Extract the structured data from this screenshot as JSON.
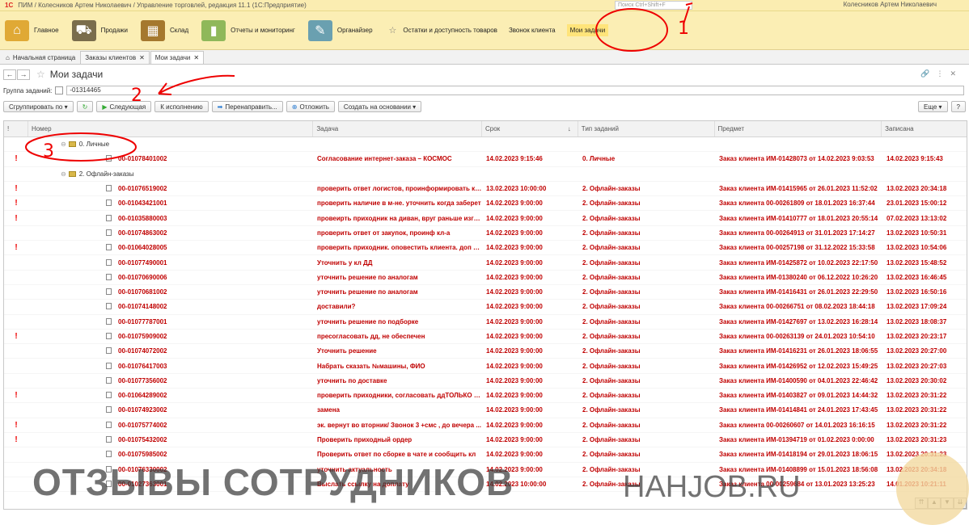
{
  "titlebar": {
    "logo": "1С",
    "title": "ПИМ / Колесников Артем Николаевич / Управление торговлей, редакция 11.1 (1С:Предприятие)",
    "search_placeholder": "Поиск Ctrl+Shift+F",
    "user": "Колесников Артем Николаевич"
  },
  "sections": [
    {
      "label": "Главное",
      "icon": "home-icon",
      "color": "#e0a935"
    },
    {
      "label": "Продажи",
      "icon": "truck-icon",
      "color": "#7a6d4c"
    },
    {
      "label": "Склад",
      "icon": "warehouse-icon",
      "color": "#a5782e"
    },
    {
      "label": "Отчеты и мониторинг",
      "icon": "report-icon",
      "color": "#8fb85a"
    },
    {
      "label": "Органайзер",
      "icon": "organizer-icon",
      "color": "#6aa0b0"
    }
  ],
  "favorites": [
    "Остатки и доступность товаров",
    "Звонок клиента",
    "Мои задачи"
  ],
  "tabs": [
    {
      "label": "Начальная страница"
    },
    {
      "label": "Заказы клиентов"
    },
    {
      "label": "Мои задачи"
    }
  ],
  "form": {
    "title": "Мои задачи",
    "filter_label": "Группа заданий:",
    "filter_value": "-01314465"
  },
  "toolbar": {
    "group_by": "Сгруппировать по",
    "next": "Следующая",
    "to_execute": "К исполнению",
    "redirect": "Перенаправить...",
    "postpone": "Отложить",
    "create_based": "Создать на основании",
    "more": "Еще",
    "help": "?"
  },
  "columns": {
    "number": "Номер",
    "task": "Задача",
    "due": "Срок",
    "type": "Тип заданий",
    "subject": "Предмет",
    "recorded": "Записана"
  },
  "groups": {
    "personal": "0. Личные",
    "offline": "2. Офлайн-заказы"
  },
  "personal_rows": [
    {
      "mark": "!",
      "num": "00-01078401002",
      "task": "Согласование интернет-заказа – КОСМОС",
      "due": "14.02.2023 9:15:46",
      "type": "0. Личные",
      "subj": "Заказ клиента ИМ-01428073 от 14.02.2023 9:03:53",
      "rec": "14.02.2023 9:15:43"
    }
  ],
  "offline_rows": [
    {
      "mark": "!",
      "num": "00-01076519002",
      "task": "проверить ответ логистов, проинформировать кл-а",
      "due": "13.02.2023 10:00:00",
      "type": "2. Офлайн-заказы",
      "subj": "Заказ клиента ИМ-01415965 от 26.01.2023 11:52:02",
      "rec": "13.02.2023 20:34:18"
    },
    {
      "mark": "!",
      "num": "00-01043421001",
      "task": "проверить наличие в м-не. уточнить когда заберет",
      "due": "14.02.2023 9:00:00",
      "type": "2. Офлайн-заказы",
      "subj": "Заказ клиента 00-00261809 от 18.01.2023 16:37:44",
      "rec": "23.01.2023 15:00:12"
    },
    {
      "mark": "!",
      "num": "00-01035880003",
      "task": "провеирть приходник на диван, вруг раньше изгото...",
      "due": "14.02.2023 9:00:00",
      "type": "2. Офлайн-заказы",
      "subj": "Заказ клиента ИМ-01410777 от 18.01.2023 20:55:14",
      "rec": "07.02.2023 13:13:02"
    },
    {
      "mark": "",
      "num": "00-01074863002",
      "task": "проверить ответ от закупок, проинф кл-а",
      "due": "14.02.2023 9:00:00",
      "type": "2. Офлайн-заказы",
      "subj": "Заказ клиента 00-00264913 от 31.01.2023 17:14:27",
      "rec": "13.02.2023 10:50:31"
    },
    {
      "mark": "!",
      "num": "00-01064028005",
      "task": "проверить приходник. оповестить клиента. доп но...",
      "due": "14.02.2023 9:00:00",
      "type": "2. Офлайн-заказы",
      "subj": "Заказ клиента 00-00257198 от 31.12.2022 15:33:58",
      "rec": "13.02.2023 10:54:06"
    },
    {
      "mark": "",
      "num": "00-01077490001",
      "task": "Уточнить у кл ДД",
      "due": "14.02.2023 9:00:00",
      "type": "2. Офлайн-заказы",
      "subj": "Заказ клиента ИМ-01425872 от 10.02.2023 22:17:50",
      "rec": "13.02.2023 15:48:52"
    },
    {
      "mark": "",
      "num": "00-01070690006",
      "task": "уточнить решение по аналогам",
      "due": "14.02.2023 9:00:00",
      "type": "2. Офлайн-заказы",
      "subj": "Заказ клиента ИМ-01380240 от 06.12.2022 10:26:20",
      "rec": "13.02.2023 16:46:45"
    },
    {
      "mark": "",
      "num": "00-01070681002",
      "task": "уточнить решение по аналогам",
      "due": "14.02.2023 9:00:00",
      "type": "2. Офлайн-заказы",
      "subj": "Заказ клиента ИМ-01416431 от 26.01.2023 22:29:50",
      "rec": "13.02.2023 16:50:16"
    },
    {
      "mark": "",
      "num": "00-01074148002",
      "task": "доставили?",
      "due": "14.02.2023 9:00:00",
      "type": "2. Офлайн-заказы",
      "subj": "Заказ клиента 00-00266751 от 08.02.2023 18:44:18",
      "rec": "13.02.2023 17:09:24"
    },
    {
      "mark": "",
      "num": "00-01077787001",
      "task": "уточнить решение по подборке",
      "due": "14.02.2023 9:00:00",
      "type": "2. Офлайн-заказы",
      "subj": "Заказ клиента ИМ-01427697 от 13.02.2023 16:28:14",
      "rec": "13.02.2023 18:08:37"
    },
    {
      "mark": "!",
      "num": "00-01075909002",
      "task": "пресогласовать дд, не обеспечен",
      "due": "14.02.2023 9:00:00",
      "type": "2. Офлайн-заказы",
      "subj": "Заказ клиента 00-00263139 от 24.01.2023 10:54:10",
      "rec": "13.02.2023 20:23:17"
    },
    {
      "mark": "",
      "num": "00-01074072002",
      "task": "Уточнить решение",
      "due": "14.02.2023 9:00:00",
      "type": "2. Офлайн-заказы",
      "subj": "Заказ клиента ИМ-01416231 от 26.01.2023 18:06:55",
      "rec": "13.02.2023 20:27:00"
    },
    {
      "mark": "",
      "num": "00-01076417003",
      "task": "Набрать сказать №машины, ФИО",
      "due": "14.02.2023 9:00:00",
      "type": "2. Офлайн-заказы",
      "subj": "Заказ клиента ИМ-01426952 от 12.02.2023 15:49:25",
      "rec": "13.02.2023 20:27:03"
    },
    {
      "mark": "",
      "num": "00-01077356002",
      "task": "уточнить по доставке",
      "due": "14.02.2023 9:00:00",
      "type": "2. Офлайн-заказы",
      "subj": "Заказ клиента ИМ-01400590 от 04.01.2023 22:46:42",
      "rec": "13.02.2023 20:30:02"
    },
    {
      "mark": "!",
      "num": "00-01064289002",
      "task": "проверить приходники, согласовать ддТОЛЬКО П...",
      "due": "14.02.2023 9:00:00",
      "type": "2. Офлайн-заказы",
      "subj": "Заказ клиента ИМ-01403827 от 09.01.2023 14:44:32",
      "rec": "13.02.2023 20:31:22"
    },
    {
      "mark": "",
      "num": "00-01074923002",
      "task": "замена",
      "due": "14.02.2023 9:00:00",
      "type": "2. Офлайн-заказы",
      "subj": "Заказ клиента ИМ-01414841 от 24.01.2023 17:43:45",
      "rec": "13.02.2023 20:31:22"
    },
    {
      "mark": "!",
      "num": "00-01075774002",
      "task": "эк. вернут во вторник/ Звонок 3 +смс , до вечера ...",
      "due": "14.02.2023 9:00:00",
      "type": "2. Офлайн-заказы",
      "subj": "Заказ клиента 00-00260607 от 14.01.2023 16:16:15",
      "rec": "13.02.2023 20:31:22"
    },
    {
      "mark": "!",
      "num": "00-01075432002",
      "task": "Проверить приходный ордер",
      "due": "14.02.2023 9:00:00",
      "type": "2. Офлайн-заказы",
      "subj": "Заказ клиента ИМ-01394719 от 01.02.2023 0:00:00",
      "rec": "13.02.2023 20:31:23"
    },
    {
      "mark": "",
      "num": "00-01075985002",
      "task": "Проверить ответ по сборке в чате и сообщить кл",
      "due": "14.02.2023 9:00:00",
      "type": "2. Офлайн-заказы",
      "subj": "Заказ клиента ИМ-01418194 от 29.01.2023 18:06:15",
      "rec": "13.02.2023 20:31:23"
    },
    {
      "mark": "",
      "num": "00-01076330002",
      "task": "уточнить актуальность",
      "due": "14.02.2023 9:00:00",
      "type": "2. Офлайн-заказы",
      "subj": "Заказ клиента ИМ-01408899 от 15.01.2023 18:56:08",
      "rec": "13.02.2023 20:34:18"
    },
    {
      "mark": "",
      "num": "00-01027363001",
      "task": "Выслать ссылку на доплату",
      "due": "14.02.2023 10:00:00",
      "type": "2. Офлайн-заказы",
      "subj": "Заказ клиента 00-00259684 от 13.01.2023 13:25:23",
      "rec": "14.01.2023 10:21:11"
    }
  ],
  "watermark": {
    "left": "ОТЗЫВЫ СОТРУДНИКОВ",
    "right": "HAHJOB.RU"
  },
  "annotations": [
    "1",
    "2",
    "3"
  ]
}
